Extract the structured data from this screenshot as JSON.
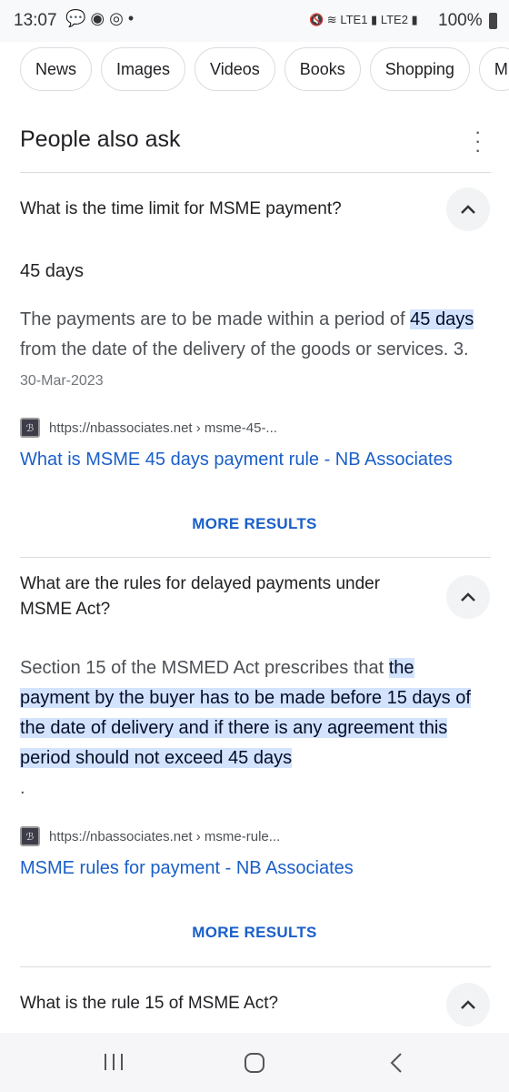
{
  "status": {
    "time": "13:07",
    "battery": "100%",
    "sim1": "LTE1",
    "sim2": "LTE2"
  },
  "chips": [
    "News",
    "Images",
    "Videos",
    "Books",
    "Shopping",
    "M"
  ],
  "paa": {
    "title": "People also ask"
  },
  "q1": {
    "question": "What is the time limit for MSME payment?",
    "answer": "45 days",
    "p1": "The payments are to be made within a period of ",
    "hl": "45 days",
    "p2": " from the date of the delivery of the goods or services. 3. ",
    "date": "30-Mar-2023",
    "source": "https://nbassociates.net › msme-45-...",
    "link": "What is MSME 45 days payment rule - NB Associates",
    "more": "MORE RESULTS"
  },
  "q2": {
    "question": "What are the rules for delayed payments under MSME Act?",
    "p1": "Section 15 of the MSMED Act prescribes that ",
    "hl": "the payment by the buyer has to be made before 15 days of the date of delivery and if there is any agreement this period should not exceed 45 days",
    "p2": " .",
    "source": "https://nbassociates.net › msme-rule...",
    "link": "MSME rules for payment - NB Associates",
    "more": "MORE RESULTS"
  },
  "q3": {
    "question": "What is the rule 15 of MSME Act?"
  }
}
